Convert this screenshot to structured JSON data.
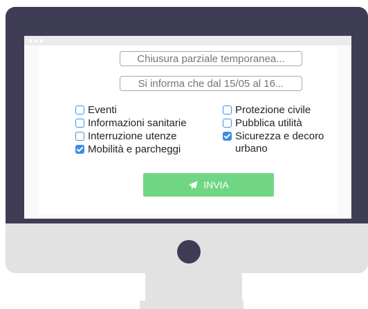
{
  "form": {
    "subject_placeholder": "Chiusura parziale temporanea...",
    "message_placeholder": "Si informa che dal 15/05 al 16...",
    "categories_left": [
      {
        "label": "Eventi",
        "checked": false
      },
      {
        "label": "Informazioni sanitarie",
        "checked": false
      },
      {
        "label": "Interruzione utenze",
        "checked": false
      },
      {
        "label": "Mobilità e parcheggi",
        "checked": true
      }
    ],
    "categories_right": [
      {
        "label": "Protezione civile",
        "checked": false
      },
      {
        "label": "Pubblica utilità",
        "checked": false
      },
      {
        "label": "Sicurezza e decoro urbano",
        "checked": true
      }
    ],
    "submit_label": "INVIA",
    "submit_icon": "paper-plane-icon"
  },
  "colors": {
    "bezel": "#3f3d56",
    "monitor_body": "#e2e2e2",
    "checkbox_accent": "#3a8ee6",
    "submit_button": "#71d683"
  }
}
